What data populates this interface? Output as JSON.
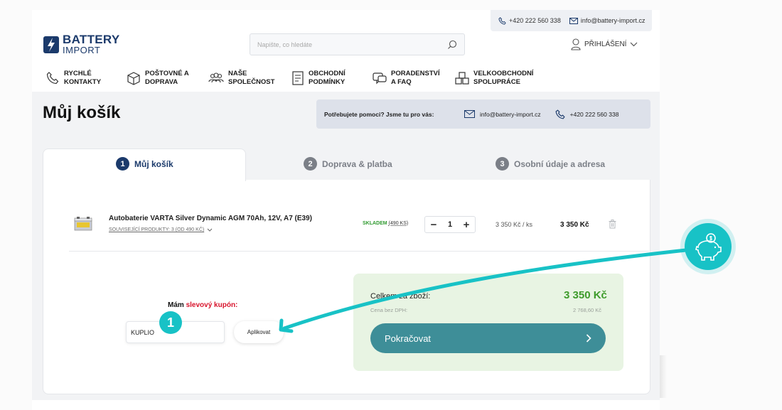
{
  "header": {
    "phone": "+420 222 560 338",
    "email": "info@battery-import.cz",
    "logo_line1": "BATTERY",
    "logo_line2": "IMPORT",
    "search_placeholder": "Napište, co hledáte",
    "login_label": "PŘIHLÁŠENÍ"
  },
  "nav": [
    {
      "line1": "RYCHLÉ",
      "line2": "KONTAKTY",
      "icon": "phone-icon"
    },
    {
      "line1": "POŠTOVNÉ A",
      "line2": "DOPRAVA",
      "icon": "box-icon"
    },
    {
      "line1": "NAŠE",
      "line2": "SPOLEČNOST",
      "icon": "people-icon"
    },
    {
      "line1": "OBCHODNÍ",
      "line2": "PODMÍNKY",
      "icon": "document-icon"
    },
    {
      "line1": "PORADENSTVÍ",
      "line2": "A FAQ",
      "icon": "chat-icon"
    },
    {
      "line1": "VELKOOBCHODNÍ",
      "line2": "SPOLUPRÁCE",
      "icon": "boxes-icon"
    }
  ],
  "page_title": "Můj košík",
  "help": {
    "question": "Potřebujete pomoci? Jsme tu pro vás:",
    "email": "info@battery-import.cz",
    "phone": "+420 222 560 338"
  },
  "steps": [
    {
      "num": "1",
      "label": "Můj košík",
      "active": true
    },
    {
      "num": "2",
      "label": "Doprava & platba",
      "active": false
    },
    {
      "num": "3",
      "label": "Osobní údaje a adresa",
      "active": false
    }
  ],
  "cart_item": {
    "name": "Autobaterie VARTA Silver Dynamic AGM 70Ah, 12V, A7 (E39)",
    "related": "SOUVISEJÍCÍ PRODUKTY: 3 (OD 490 KČ)",
    "stock": "SKLADEM",
    "stock_count": "(490 KS)",
    "quantity": "1",
    "unit_price": "3 350 Kč  / ks",
    "total": "3 350 Kč"
  },
  "coupon": {
    "label_prefix": "Mám",
    "label_highlight": "slevový kupón:",
    "value": "KUPLIO",
    "apply_label": "Aplikovat",
    "badge": "1"
  },
  "summary": {
    "label": "Celkem za zboží:",
    "value": "3 350 Kč",
    "sub_label": "Cena bez DPH:",
    "sub_value": "2 768,60 Kč",
    "continue_label": "Pokračovat"
  },
  "colors": {
    "brand": "#1b3a6b",
    "accent": "#18c2c6",
    "green": "#3e9b2b",
    "button": "#3e8e98",
    "red": "#d8142c"
  }
}
